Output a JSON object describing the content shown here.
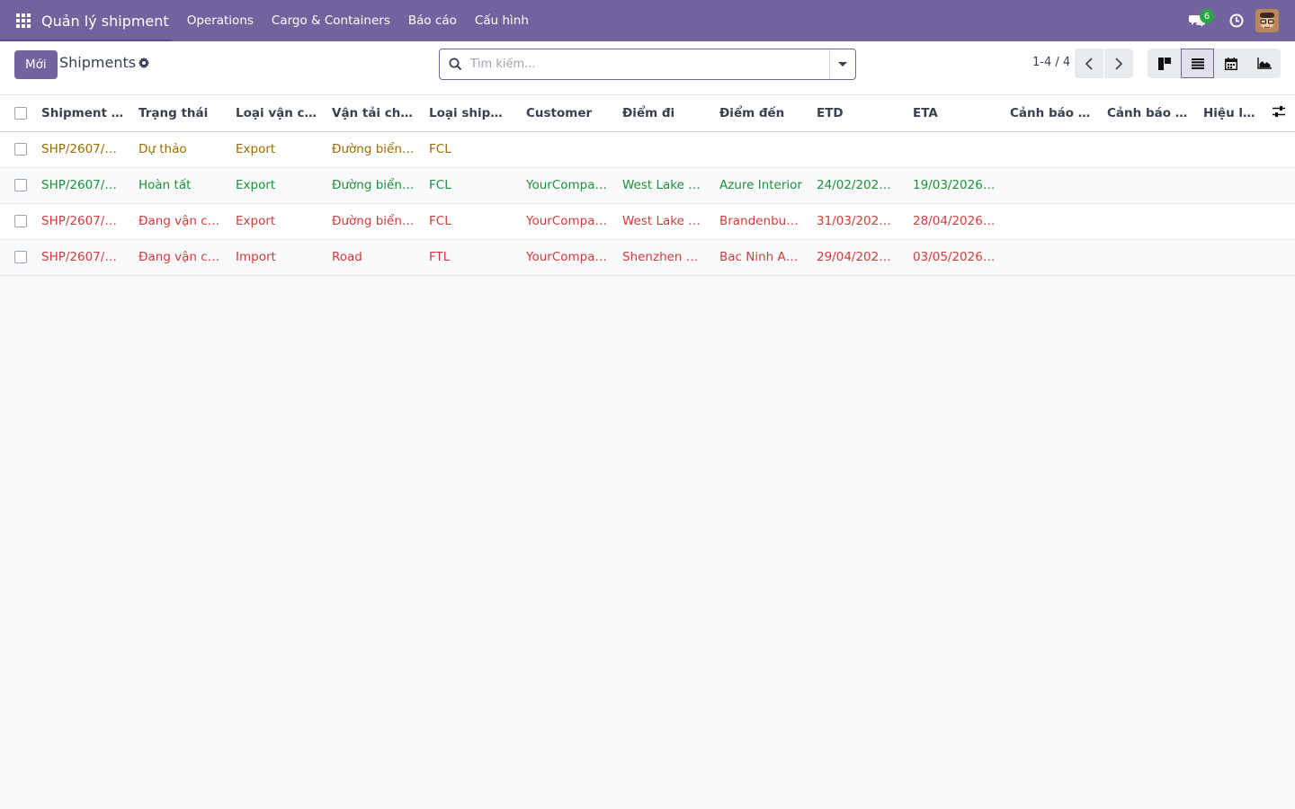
{
  "navbar": {
    "brand": "Quản lý shipment",
    "menu": [
      "Operations",
      "Cargo & Containers",
      "Báo cáo",
      "Cấu hình"
    ],
    "chat_badge": "6"
  },
  "control": {
    "new_label": "Mới",
    "breadcrumb": "Shipments",
    "search_placeholder": "Tìm kiếm...",
    "pager": "1-4 / 4"
  },
  "table": {
    "columns": [
      "Shipment ...",
      "Trạng thái",
      "Loại vận ch...",
      "Vận tải chính",
      "Loại shipm...",
      "Customer",
      "Điểm đi",
      "Điểm đến",
      "ETD",
      "ETA",
      "Cảnh báo t...",
      "Cảnh báo c...",
      "Hiệu lực"
    ],
    "rows": [
      {
        "status": "draft",
        "cells": [
          "SHP/2607/00...",
          "Dự thảo",
          "Export",
          "Đường biển /...",
          "FCL",
          "",
          "",
          "",
          "",
          "",
          "",
          "",
          ""
        ]
      },
      {
        "status": "done",
        "cells": [
          "SHP/2607/00...",
          "Hoàn tất",
          "Export",
          "Đường biển /...",
          "FCL",
          "YourCompan...",
          "West Lake H...",
          "Azure Interior",
          "24/02/2026 ...",
          "19/03/2026 ...",
          "",
          "",
          ""
        ]
      },
      {
        "status": "danger",
        "cells": [
          "SHP/2607/00...",
          "Đang vận ch...",
          "Export",
          "Đường biển /...",
          "FCL",
          "YourCompan...",
          "West Lake H...",
          "Brandenburg...",
          "31/03/2026 ...",
          "28/04/2026 ...",
          "",
          "",
          ""
        ]
      },
      {
        "status": "danger",
        "cells": [
          "SHP/2607/00...",
          "Đang vận ch...",
          "Import",
          "Road",
          "FTL",
          "YourCompan...",
          "Shenzhen Co...",
          "Bac Ninh Ass...",
          "29/04/2026 ...",
          "03/05/2026 ...",
          "",
          "",
          ""
        ]
      }
    ]
  },
  "colors": {
    "brand": "#71639e",
    "draft": "#9a6b00",
    "done": "#1e8f3a",
    "danger": "#d23b3b"
  }
}
